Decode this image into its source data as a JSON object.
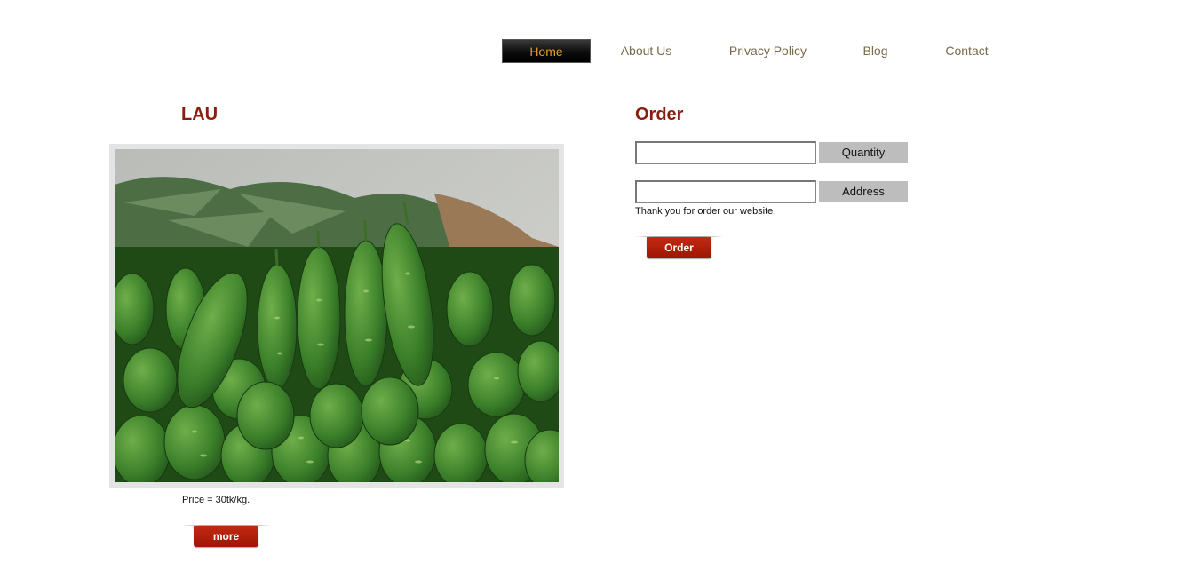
{
  "nav": {
    "items": [
      {
        "label": "Home",
        "active": true
      },
      {
        "label": "About Us",
        "active": false
      },
      {
        "label": "Privacy Policy",
        "active": false
      },
      {
        "label": "Blog",
        "active": false
      },
      {
        "label": "Contact",
        "active": false
      }
    ]
  },
  "product": {
    "title": "LAU",
    "price_text": "Price = 30tk/kg.",
    "more_label": "more"
  },
  "order": {
    "title": "Order",
    "quantity_value": "",
    "quantity_label": "Quantity",
    "address_value": "",
    "address_label": "Address",
    "thanks_text": "Thank you for order our website",
    "submit_label": "Order"
  },
  "colors": {
    "heading": "#8a1e0c",
    "nav_text": "#7a6a4a",
    "nav_active_text": "#e89a2a",
    "button": "#b0200a"
  }
}
